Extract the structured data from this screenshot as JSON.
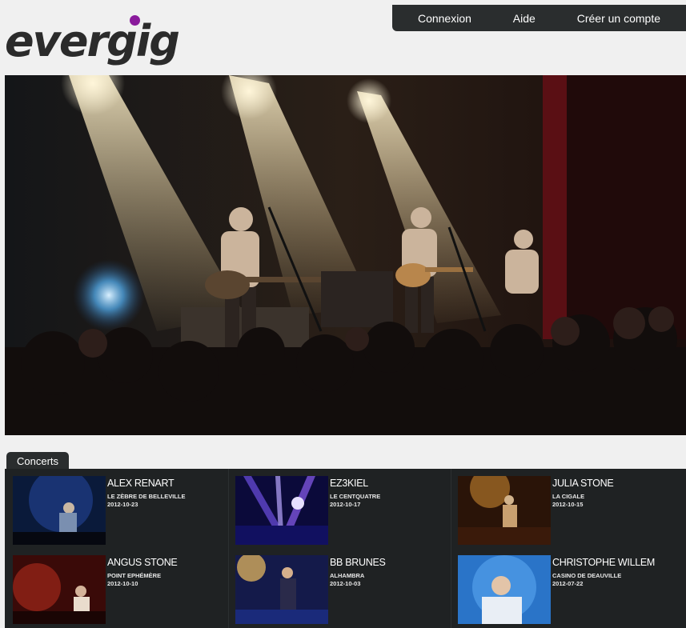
{
  "nav": {
    "login": "Connexion",
    "help": "Aide",
    "signup": "Créer un compte"
  },
  "brand": {
    "logo_text": "evergig",
    "accent": "#8a1b9c"
  },
  "concerts": {
    "tab_label": "Concerts",
    "items": [
      {
        "artist": "ALEX RENART",
        "venue": "LE ZÈBRE DE BELLEVILLE",
        "date": "2012-10-23"
      },
      {
        "artist": "EZ3KIEL",
        "venue": "LE CENTQUATRE",
        "date": "2012-10-17"
      },
      {
        "artist": "JULIA STONE",
        "venue": "LA CIGALE",
        "date": "2012-10-15"
      },
      {
        "artist": "ANGUS STONE",
        "venue": "POINT EPHÉMÈRE",
        "date": "2012-10-10"
      },
      {
        "artist": "BB BRUNES",
        "venue": "ALHAMBRA",
        "date": "2012-10-03"
      },
      {
        "artist": "CHRISTOPHE WILLEM",
        "venue": "CASINO DE DEAUVILLE",
        "date": "2012-07-22"
      }
    ]
  }
}
